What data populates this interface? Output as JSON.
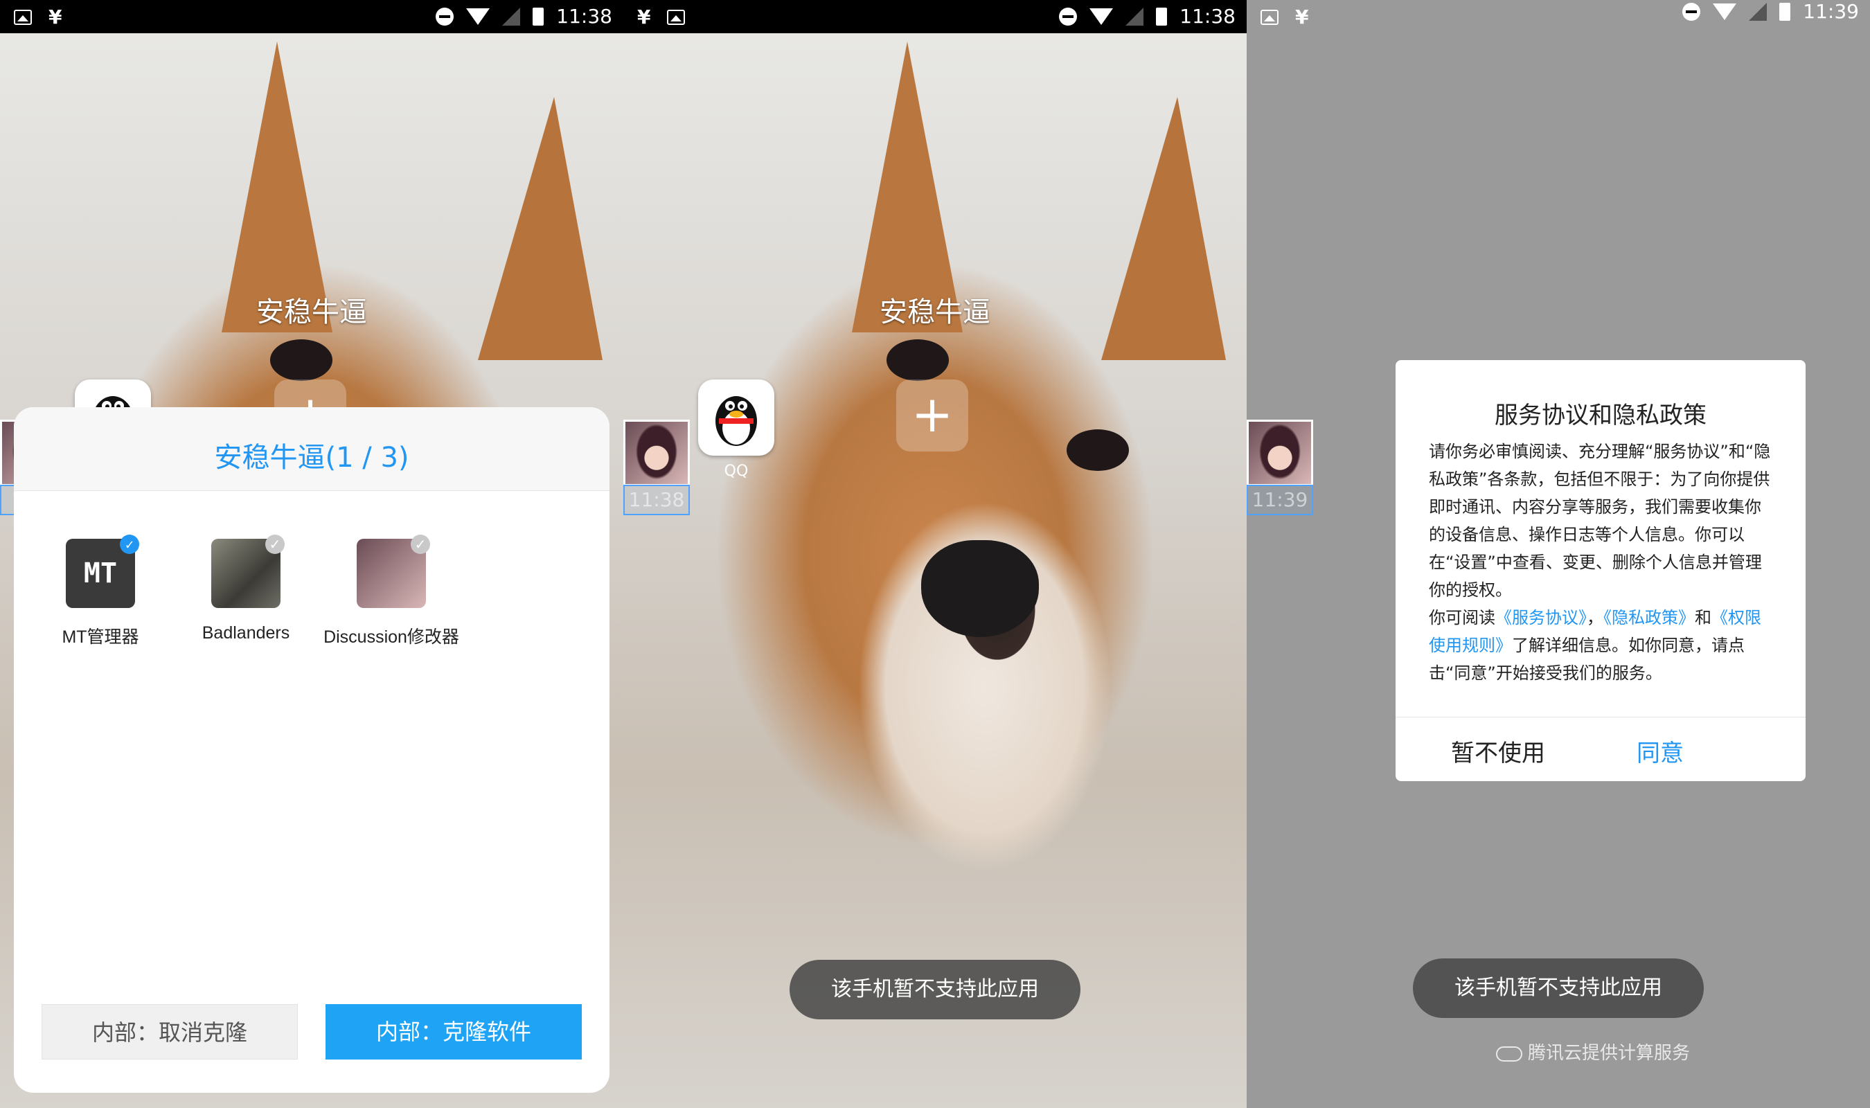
{
  "panel1": {
    "status": {
      "yen": "¥",
      "time": "11:38"
    },
    "folder_title": "安稳牛逼",
    "float_time": "1:38",
    "sheet_title": "安稳牛逼(1 / 3)",
    "apps": [
      {
        "name": "MT管理器",
        "icon_text": "MT",
        "checked": true
      },
      {
        "name": "Badlanders",
        "checked": false
      },
      {
        "name": "Discussion修改器",
        "checked": false
      }
    ],
    "cancel_button": "内部：取消克隆",
    "clone_button": "内部：克隆软件"
  },
  "panel2": {
    "status": {
      "yen": "¥",
      "time": "11:38"
    },
    "folder_title": "安稳牛逼",
    "qq_label": "QQ",
    "float_time": "11:38",
    "toast": "该手机暂不支持此应用"
  },
  "panel3": {
    "status": {
      "yen": "¥",
      "time": "11:39"
    },
    "float_time": "11:39",
    "dialog": {
      "title": "服务协议和隐私政策",
      "body_p1": "请你务必审慎阅读、充分理解“服务协议”和“隐私政策”各条款，包括但不限于：为了向你提供即时通讯、内容分享等服务，我们需要收集你的设备信息、操作日志等个人信息。你可以在“设置”中查看、变更、删除个人信息并管理你的授权。",
      "body_p2_pre": "你可阅读",
      "link_service": "《服务协议》",
      "sep1": "，",
      "link_privacy": "《隐私政策》",
      "and": "和",
      "link_perm": "《权限使用规则》",
      "body_p2_post": "了解详细信息。如你同意，请点击“同意”开始接受我们的服务。",
      "decline": "暂不使用",
      "agree": "同意"
    },
    "toast": "该手机暂不支持此应用",
    "credit": "腾讯云提供计算服务"
  }
}
